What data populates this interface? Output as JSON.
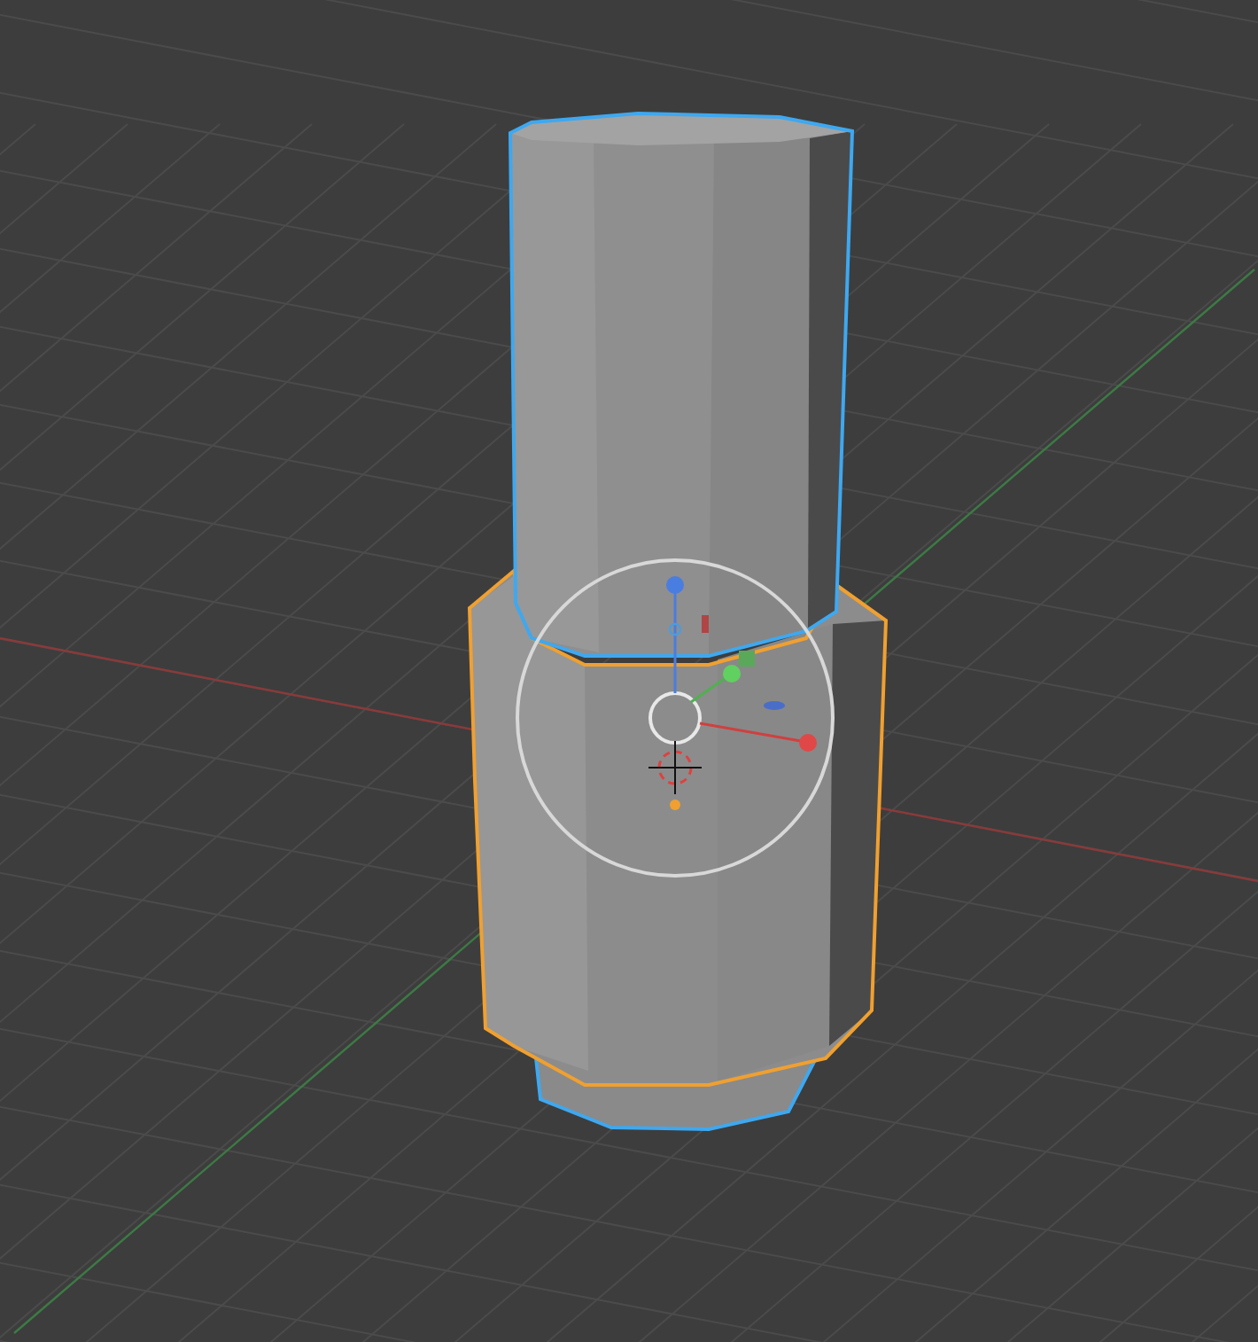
{
  "objects": [
    {
      "kind": "upper-cylinder",
      "color": "#3ea8f0"
    },
    {
      "kind": "lower-cylinder",
      "color": "#f0a030"
    }
  ]
}
